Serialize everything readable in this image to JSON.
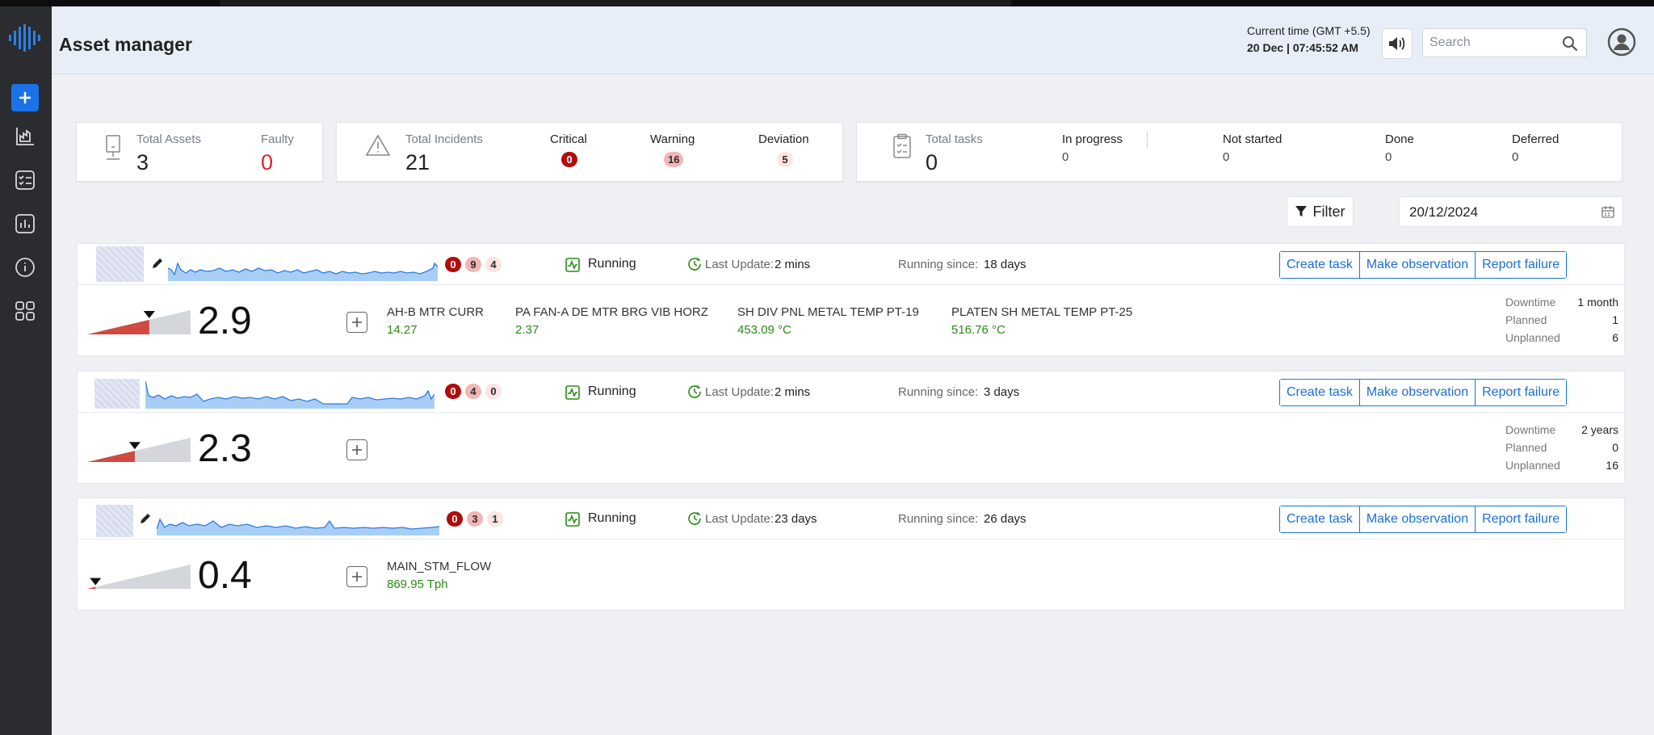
{
  "header": {
    "title": "Asset manager",
    "time_label": "Current time (GMT +5.5)",
    "time_value": "20 Dec | 07:45:52 AM",
    "search_placeholder": "Search"
  },
  "sidebar": {
    "icons": [
      "logo-icon",
      "add-icon",
      "factory-chart-icon",
      "checklist-icon",
      "report-icon",
      "info-icon",
      "apps-grid-icon"
    ]
  },
  "summary": {
    "assets": {
      "total_label": "Total Assets",
      "total": "3",
      "faulty_label": "Faulty",
      "faulty": "0"
    },
    "incidents": {
      "total_label": "Total Incidents",
      "total": "21",
      "critical_label": "Critical",
      "critical": "0",
      "warning_label": "Warning",
      "warning": "16",
      "deviation_label": "Deviation",
      "deviation": "5"
    },
    "tasks": {
      "total_label": "Total tasks",
      "total": "0",
      "in_progress_label": "In progress",
      "in_progress": "0",
      "not_started_label": "Not started",
      "not_started": "0",
      "done_label": "Done",
      "done": "0",
      "deferred_label": "Deferred",
      "deferred": "0"
    }
  },
  "toolbar": {
    "filter_label": "Filter",
    "date": "20/12/2024"
  },
  "assets": [
    {
      "badges": [
        "0",
        "9",
        "4"
      ],
      "status": "Running",
      "last_update_label": "Last Update:",
      "last_update": "2 mins",
      "running_since_label": "Running since:",
      "running_since": "18 days",
      "actions": [
        "Create task",
        "Make observation",
        "Report failure"
      ],
      "score": "2.9",
      "gauge_level": 0.6,
      "sensors": [
        {
          "name": "AH-B MTR CURR",
          "value": "14.27"
        },
        {
          "name": "PA FAN-A DE MTR BRG VIB HORZ",
          "value": "2.37"
        },
        {
          "name": "SH DIV PNL METAL TEMP PT-19",
          "value": "453.09 °C"
        },
        {
          "name": "PLATEN SH METAL TEMP PT-25",
          "value": "516.76 °C"
        }
      ],
      "stats": {
        "downtime_label": "Downtime",
        "downtime": "1 month",
        "planned_label": "Planned",
        "planned": "1",
        "unplanned_label": "Unplanned",
        "unplanned": "6"
      }
    },
    {
      "badges": [
        "0",
        "4",
        "0"
      ],
      "status": "Running",
      "last_update_label": "Last Update:",
      "last_update": "2 mins",
      "running_since_label": "Running since:",
      "running_since": "3 days",
      "actions": [
        "Create task",
        "Make observation",
        "Report failure"
      ],
      "score": "2.3",
      "gauge_level": 0.46,
      "sensors": [],
      "stats": {
        "downtime_label": "Downtime",
        "downtime": "2 years",
        "planned_label": "Planned",
        "planned": "0",
        "unplanned_label": "Unplanned",
        "unplanned": "16"
      }
    },
    {
      "badges": [
        "0",
        "3",
        "1"
      ],
      "status": "Running",
      "last_update_label": "Last Update:",
      "last_update": "23 days",
      "running_since_label": "Running since:",
      "running_since": "26 days",
      "actions": [
        "Create task",
        "Make observation",
        "Report failure"
      ],
      "score": "0.4",
      "gauge_level": 0.08,
      "sensors": [
        {
          "name": "MAIN_STM_FLOW",
          "value": "869.95 Tph"
        }
      ],
      "stats": null
    }
  ],
  "colors": {
    "accent": "#1a73e8",
    "critical": "#b00d0d",
    "warning": "#f2b6b6",
    "deviation": "#fde3e3",
    "ok_value": "#2a8a17",
    "faulty": "#d9262e"
  }
}
